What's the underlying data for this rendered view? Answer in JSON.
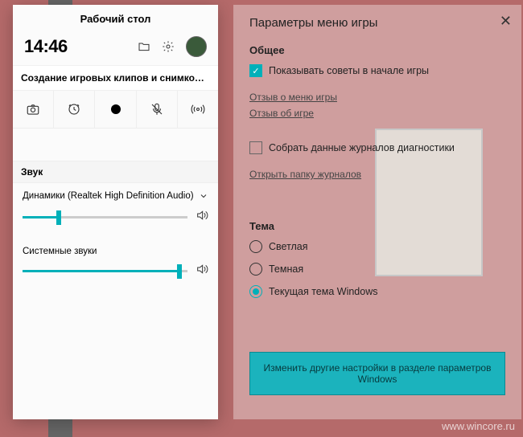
{
  "left": {
    "title": "Рабочий стол",
    "time": "14:46",
    "notice": "Создание игровых клипов и снимков экр...",
    "sound": {
      "section_title": "Звук",
      "device": "Динамики (Realtek High Definition Audio)",
      "device_volume": 22,
      "system_label": "Системные звуки",
      "system_volume": 95
    }
  },
  "right": {
    "title": "Параметры меню игры",
    "general": {
      "heading": "Общее",
      "show_tips": "Показывать советы в начале игры",
      "link_menu_feedback": "Отзыв о меню игры",
      "link_game_feedback": "Отзыв об игре",
      "collect_logs": "Собрать данные журналов диагностики",
      "open_logs": "Открыть папку журналов"
    },
    "theme": {
      "heading": "Тема",
      "light": "Светлая",
      "dark": "Темная",
      "current": "Текущая тема Windows"
    },
    "button": "Изменить другие настройки в разделе параметров Windows"
  },
  "watermark": "www.wincore.ru"
}
